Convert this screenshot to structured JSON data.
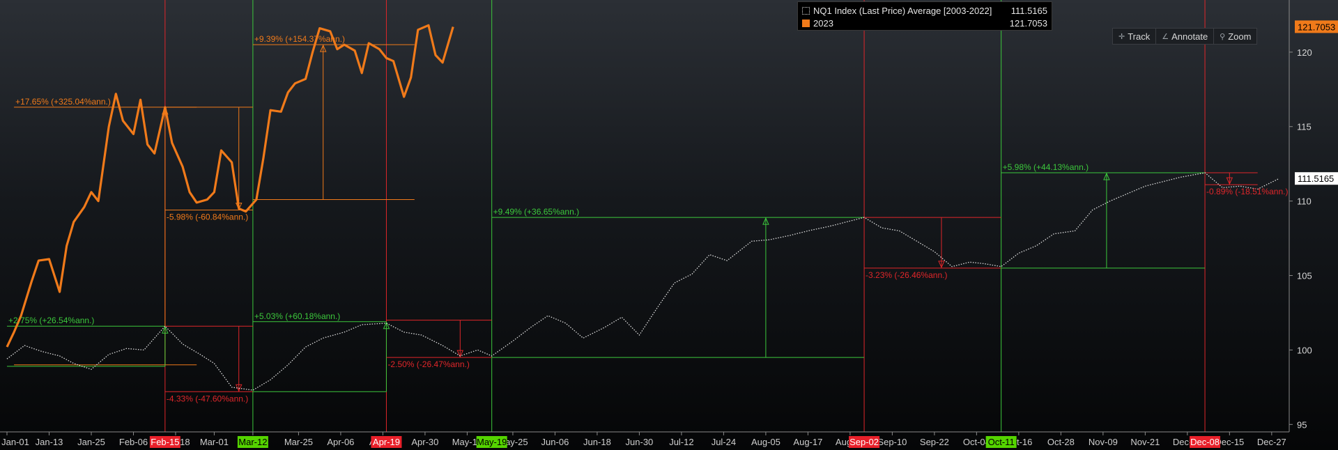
{
  "legend": {
    "series1_label": "NQ1 Index (Last Price) Average [2003-2022]",
    "series1_value": "111.5165",
    "series2_label": "2023",
    "series2_value": "121.7053"
  },
  "toolbar": {
    "track": "Track",
    "annotate": "Annotate",
    "zoom": "Zoom"
  },
  "icons": {
    "track": "crosshair-icon",
    "annotate": "pencil-icon",
    "zoom": "magnifier-icon"
  },
  "colors": {
    "avg": "#dddddd",
    "y2023": "#f07a1a",
    "up": "#3cc83c",
    "down": "#e0262a",
    "orange_ann": "#f07a1a"
  },
  "chart_data": {
    "type": "line",
    "ylim": [
      94.5,
      123.5
    ],
    "y_ticks": [
      95,
      100,
      105,
      110,
      115,
      120
    ],
    "x_tick_labels": [
      "Jan-01",
      "Jan-13",
      "Jan-25",
      "Feb-06",
      "Feb-18",
      "Mar-01",
      "Mar-12",
      "Mar-25",
      "Apr-06",
      "Apr-18",
      "Apr-30",
      "May-12",
      "May-25",
      "Jun-06",
      "Jun-18",
      "Jun-30",
      "Jul-12",
      "Jul-24",
      "Aug-05",
      "Aug-17",
      "Aug-29",
      "Sep-10",
      "Sep-22",
      "Oct-04",
      "Oct-16",
      "Oct-28",
      "Nov-09",
      "Nov-21",
      "Dec-03",
      "Dec-15",
      "Dec-27"
    ],
    "highlighted_x_labels": [
      {
        "label": "Feb-15",
        "color": "red"
      },
      {
        "label": "Mar-12",
        "color": "green"
      },
      {
        "label": "Apr-19",
        "color": "red"
      },
      {
        "label": "May-19",
        "color": "green"
      },
      {
        "label": "Sep-02",
        "color": "red"
      },
      {
        "label": "Oct-11",
        "color": "green"
      },
      {
        "label": "Dec-08",
        "color": "red"
      }
    ],
    "last_value_labels": [
      "121.7053",
      "111.5165"
    ],
    "series": [
      {
        "name": "NQ1 Index (Last Price) Average [2003-2022]",
        "style": "dotted",
        "points": [
          [
            "Jan-01",
            99.4
          ],
          [
            "Jan-06",
            100.3
          ],
          [
            "Jan-11",
            99.9
          ],
          [
            "Jan-16",
            99.6
          ],
          [
            "Jan-20",
            99.1
          ],
          [
            "Jan-25",
            98.7
          ],
          [
            "Jan-30",
            99.7
          ],
          [
            "Feb-04",
            100.1
          ],
          [
            "Feb-09",
            100.0
          ],
          [
            "Feb-15",
            101.6
          ],
          [
            "Feb-20",
            100.4
          ],
          [
            "Feb-25",
            99.7
          ],
          [
            "Mar-01",
            99.1
          ],
          [
            "Mar-06",
            97.5
          ],
          [
            "Mar-12",
            97.3
          ],
          [
            "Mar-17",
            98.0
          ],
          [
            "Mar-22",
            99.0
          ],
          [
            "Mar-27",
            100.2
          ],
          [
            "Apr-01",
            100.8
          ],
          [
            "Apr-07",
            101.2
          ],
          [
            "Apr-12",
            101.7
          ],
          [
            "Apr-19",
            101.8
          ],
          [
            "Apr-24",
            101.2
          ],
          [
            "Apr-29",
            101.0
          ],
          [
            "May-05",
            100.3
          ],
          [
            "May-10",
            99.6
          ],
          [
            "May-15",
            100.0
          ],
          [
            "May-19",
            99.6
          ],
          [
            "May-25",
            100.6
          ],
          [
            "May-30",
            101.5
          ],
          [
            "Jun-04",
            102.3
          ],
          [
            "Jun-09",
            101.8
          ],
          [
            "Jun-14",
            100.8
          ],
          [
            "Jun-20",
            101.5
          ],
          [
            "Jun-25",
            102.2
          ],
          [
            "Jun-30",
            101.0
          ],
          [
            "Jul-05",
            102.8
          ],
          [
            "Jul-10",
            104.5
          ],
          [
            "Jul-15",
            105.1
          ],
          [
            "Jul-20",
            106.4
          ],
          [
            "Jul-25",
            106.0
          ],
          [
            "Aug-01",
            107.3
          ],
          [
            "Aug-06",
            107.4
          ],
          [
            "Aug-12",
            107.7
          ],
          [
            "Aug-17",
            108.0
          ],
          [
            "Aug-23",
            108.3
          ],
          [
            "Sep-02",
            108.9
          ],
          [
            "Sep-07",
            108.2
          ],
          [
            "Sep-12",
            108.0
          ],
          [
            "Sep-17",
            107.3
          ],
          [
            "Sep-22",
            106.6
          ],
          [
            "Sep-27",
            105.6
          ],
          [
            "Oct-02",
            105.9
          ],
          [
            "Oct-06",
            105.8
          ],
          [
            "Oct-11",
            105.6
          ],
          [
            "Oct-16",
            106.5
          ],
          [
            "Oct-21",
            107.0
          ],
          [
            "Oct-26",
            107.8
          ],
          [
            "Nov-01",
            108.0
          ],
          [
            "Nov-06",
            109.4
          ],
          [
            "Nov-11",
            110.0
          ],
          [
            "Nov-16",
            110.5
          ],
          [
            "Nov-21",
            111.0
          ],
          [
            "Nov-26",
            111.3
          ],
          [
            "Dec-01",
            111.6
          ],
          [
            "Dec-08",
            111.9
          ],
          [
            "Dec-13",
            110.9
          ],
          [
            "Dec-18",
            111.0
          ],
          [
            "Dec-23",
            110.8
          ],
          [
            "Dec-29",
            111.5
          ]
        ]
      },
      {
        "name": "2023",
        "style": "solid",
        "points": [
          [
            "Jan-01",
            100.2
          ],
          [
            "Jan-03",
            101.2
          ],
          [
            "Jan-05",
            102.3
          ],
          [
            "Jan-08",
            104.6
          ],
          [
            "Jan-10",
            106.0
          ],
          [
            "Jan-13",
            106.1
          ],
          [
            "Jan-16",
            103.9
          ],
          [
            "Jan-18",
            107.0
          ],
          [
            "Jan-20",
            108.6
          ],
          [
            "Jan-23",
            109.6
          ],
          [
            "Jan-25",
            110.6
          ],
          [
            "Jan-27",
            110.0
          ],
          [
            "Jan-30",
            115.0
          ],
          [
            "Feb-01",
            117.2
          ],
          [
            "Feb-03",
            115.4
          ],
          [
            "Feb-06",
            114.5
          ],
          [
            "Feb-08",
            116.8
          ],
          [
            "Feb-10",
            113.8
          ],
          [
            "Feb-12",
            113.2
          ],
          [
            "Feb-15",
            116.3
          ],
          [
            "Feb-17",
            113.9
          ],
          [
            "Feb-20",
            112.3
          ],
          [
            "Feb-22",
            110.6
          ],
          [
            "Feb-24",
            109.9
          ],
          [
            "Feb-27",
            110.1
          ],
          [
            "Mar-01",
            110.6
          ],
          [
            "Mar-03",
            113.4
          ],
          [
            "Mar-06",
            112.6
          ],
          [
            "Mar-08",
            109.5
          ],
          [
            "Mar-10",
            109.3
          ],
          [
            "Mar-13",
            110.1
          ],
          [
            "Mar-15",
            112.9
          ],
          [
            "Mar-17",
            116.1
          ],
          [
            "Mar-20",
            116.0
          ],
          [
            "Mar-22",
            117.3
          ],
          [
            "Mar-24",
            117.9
          ],
          [
            "Mar-27",
            118.2
          ],
          [
            "Mar-29",
            120.0
          ],
          [
            "Mar-31",
            121.6
          ],
          [
            "Apr-03",
            121.4
          ],
          [
            "Apr-05",
            120.2
          ],
          [
            "Apr-07",
            120.5
          ],
          [
            "Apr-10",
            120.1
          ],
          [
            "Apr-12",
            118.6
          ],
          [
            "Apr-14",
            120.6
          ],
          [
            "Apr-17",
            120.2
          ],
          [
            "Apr-19",
            119.6
          ],
          [
            "Apr-21",
            119.4
          ],
          [
            "Apr-24",
            117.0
          ],
          [
            "Apr-26",
            118.3
          ],
          [
            "Apr-28",
            121.5
          ],
          [
            "May-01",
            121.8
          ],
          [
            "May-03",
            119.8
          ],
          [
            "May-05",
            119.3
          ],
          [
            "May-08",
            121.7
          ]
        ]
      }
    ],
    "annotations": [
      {
        "label": "+17.65% (+325.04%ann.)",
        "color": "orange",
        "from": [
          "Jan-03",
          99.0
        ],
        "to": [
          "Feb-15",
          116.3
        ],
        "end_date": "Feb-24",
        "direction": "up"
      },
      {
        "label": "-5.98% (-60.84%ann.)",
        "color": "orange",
        "from": [
          "Feb-15",
          116.3
        ],
        "to": [
          "Mar-08",
          109.4
        ],
        "end_date": "Mar-12",
        "direction": "down"
      },
      {
        "label": "+9.39% (+154.37%ann.)",
        "color": "orange",
        "from": [
          "Mar-12",
          110.1
        ],
        "to": [
          "Apr-01",
          120.5
        ],
        "end_date": "Apr-27",
        "direction": "up"
      },
      {
        "label": "+2.75% (+26.54%ann.)",
        "color": "green",
        "from": [
          "Jan-01",
          98.9
        ],
        "to": [
          "Feb-15",
          101.6
        ],
        "end_date": "Feb-15",
        "direction": "up"
      },
      {
        "label": "-4.33% (-47.60%ann.)",
        "color": "red",
        "from": [
          "Feb-15",
          101.6
        ],
        "to": [
          "Mar-08",
          97.2
        ],
        "end_date": "Mar-12",
        "direction": "down"
      },
      {
        "label": "+5.03% (+60.18%ann.)",
        "color": "green",
        "from": [
          "Mar-12",
          97.2
        ],
        "to": [
          "Apr-19",
          101.9
        ],
        "end_date": "Apr-19",
        "direction": "up"
      },
      {
        "label": "-2.50% (-26.47%ann.)",
        "color": "red",
        "from": [
          "Apr-19",
          102.0
        ],
        "to": [
          "May-10",
          99.5
        ],
        "end_date": "May-19",
        "direction": "down"
      },
      {
        "label": "+9.49% (+36.65%ann.)",
        "color": "green",
        "from": [
          "May-19",
          99.5
        ],
        "to": [
          "Aug-05",
          108.9
        ],
        "end_date": "Sep-02",
        "direction": "up"
      },
      {
        "label": "-3.23% (-26.46%ann.)",
        "color": "red",
        "from": [
          "Sep-02",
          108.9
        ],
        "to": [
          "Sep-24",
          105.5
        ],
        "end_date": "Oct-11",
        "direction": "down"
      },
      {
        "label": "+5.98% (+44.13%ann.)",
        "color": "green",
        "from": [
          "Oct-11",
          105.5
        ],
        "to": [
          "Nov-10",
          111.9
        ],
        "end_date": "Dec-08",
        "direction": "up"
      },
      {
        "label": "-0.89% (-18.51%ann.)",
        "color": "red",
        "from": [
          "Dec-08",
          111.9
        ],
        "to": [
          "Dec-15",
          111.1
        ],
        "end_date": "Dec-23",
        "direction": "down"
      }
    ]
  }
}
